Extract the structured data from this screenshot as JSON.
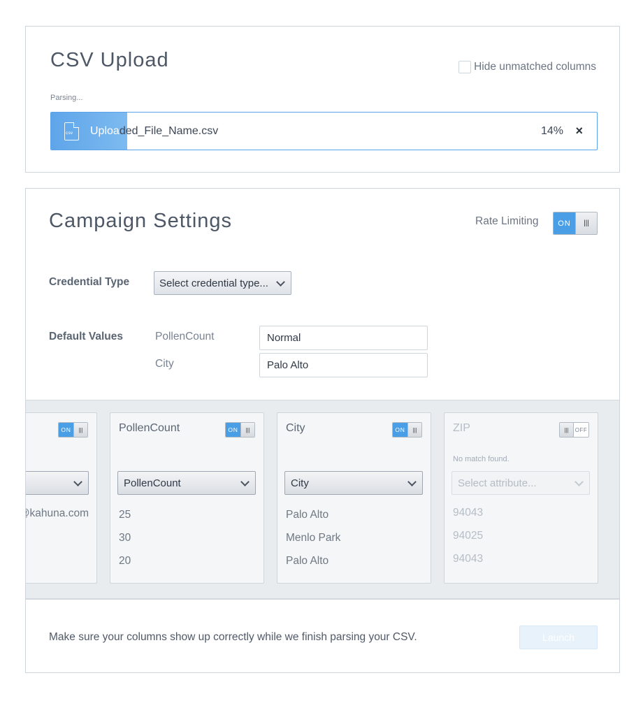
{
  "upload": {
    "title": "CSV Upload",
    "hide_unmatched_label": "Hide unmatched columns",
    "hide_unmatched_checked": false,
    "status": "Parsing...",
    "file_icon_text": "csv",
    "file_name_part1": "Uploa",
    "file_name_part2": "ded_File_Name.csv",
    "progress_value": 0.14,
    "progress_text": "14%",
    "close_symbol": "×"
  },
  "campaign": {
    "title": "Campaign Settings",
    "rate_limiting": {
      "label": "Rate Limiting",
      "state": "ON",
      "knob": "|||"
    },
    "credential": {
      "label": "Credential Type",
      "placeholder": "Select credential type..."
    },
    "defaults": {
      "label": "Default Values",
      "fields": [
        {
          "name": "PollenCount",
          "value": "Normal"
        },
        {
          "name": "City",
          "value": "Palo Alto"
        }
      ]
    },
    "columns": [
      {
        "title": "",
        "toggle": "ON",
        "select_value": "",
        "values": [
          "@kahuna.com"
        ]
      },
      {
        "title": "PollenCount",
        "toggle": "ON",
        "select_value": "PollenCount",
        "values": [
          "25",
          "30",
          "20"
        ]
      },
      {
        "title": "City",
        "toggle": "ON",
        "select_value": "City",
        "values": [
          "Palo Alto",
          "Menlo Park",
          "Palo Alto"
        ]
      },
      {
        "title": "ZIP",
        "toggle": "OFF",
        "no_match": "No match found.",
        "select_placeholder": "Select attribute...",
        "values": [
          "94043",
          "94025",
          "94043"
        ]
      }
    ],
    "footer_text": "Make sure your columns show up correctly while we finish parsing your CSV.",
    "launch_label": "Launch",
    "toggle_knob": "|||"
  },
  "colors": {
    "accent": "#4a9ee6",
    "border": "#cfd5dc",
    "columns_bg": "#e9ecef"
  }
}
